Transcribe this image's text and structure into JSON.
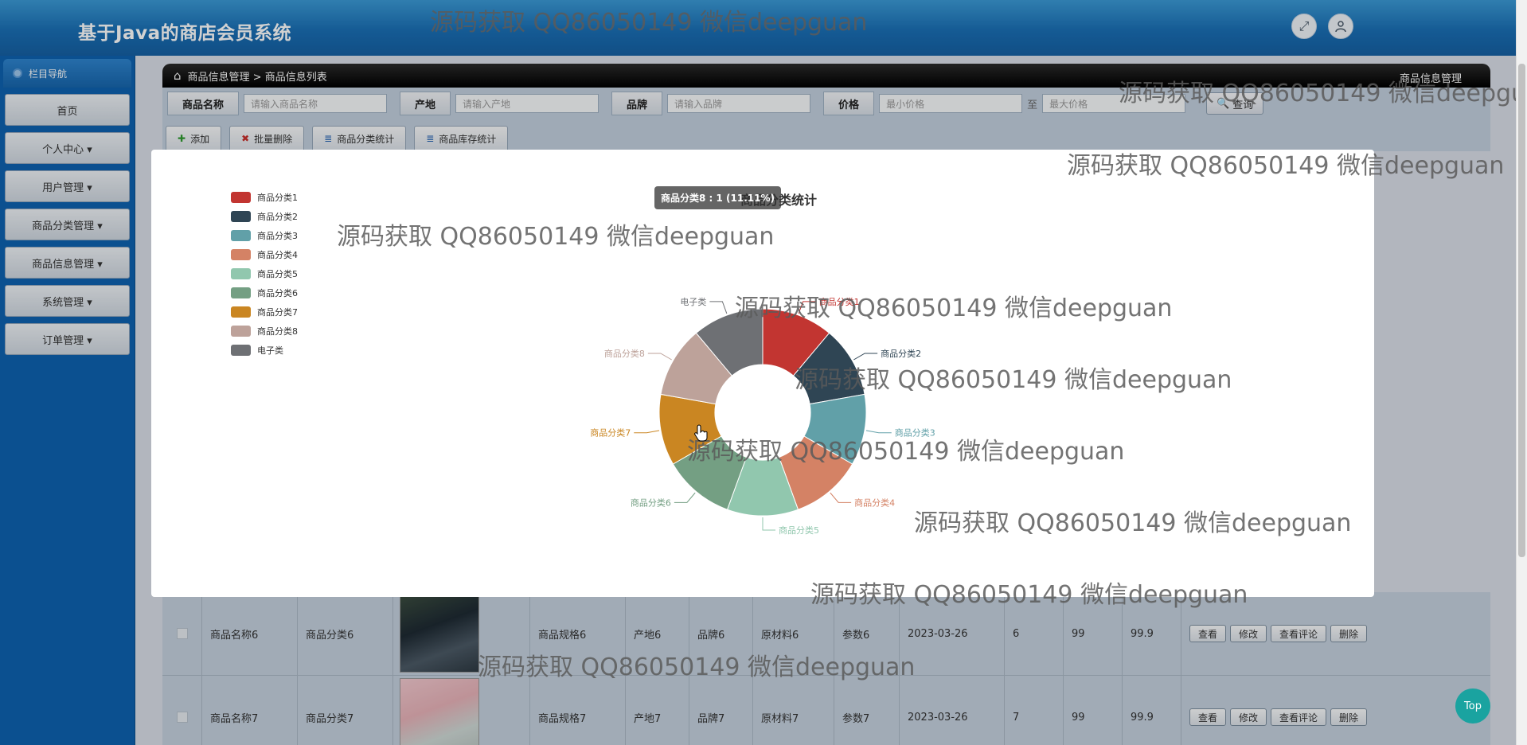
{
  "app": {
    "title": "基于Java的商店会员系统"
  },
  "header": {
    "fullscreen_icon": "expand-icon",
    "user_icon": "user-icon"
  },
  "sidebar": {
    "title": "栏目导航",
    "items": [
      {
        "label": "首页"
      },
      {
        "label": "个人中心 ▾"
      },
      {
        "label": "用户管理 ▾"
      },
      {
        "label": "商品分类管理 ▾"
      },
      {
        "label": "商品信息管理 ▾"
      },
      {
        "label": "系统管理 ▾"
      },
      {
        "label": "订单管理 ▾"
      }
    ]
  },
  "breadcrumb": {
    "home_icon": "home-icon",
    "path": "商品信息管理 > 商品信息列表",
    "right": "商品信息管理"
  },
  "search": {
    "name_label": "商品名称",
    "name_placeholder": "请输入商品名称",
    "origin_label": "产地",
    "origin_placeholder": "请输入产地",
    "brand_label": "品牌",
    "brand_placeholder": "请输入品牌",
    "price_label": "价格",
    "min_placeholder": "最小价格",
    "sep": "至",
    "max_placeholder": "最大价格",
    "query_label": "查询"
  },
  "toolbar": {
    "add_label": "添加",
    "batch_delete_label": "批量删除",
    "category_stats_label": "商品分类统计",
    "stock_stats_label": "商品库存统计"
  },
  "table": {
    "rows": [
      {
        "name": "商品名称6",
        "category": "商品分类6",
        "spec": "商品规格6",
        "origin": "产地6",
        "brand": "品牌6",
        "material": "原材料6",
        "param": "参数6",
        "date": "2023-03-26",
        "a": "6",
        "b": "99",
        "price": "99.9"
      },
      {
        "name": "商品名称7",
        "category": "商品分类7",
        "spec": "商品规格7",
        "origin": "产地7",
        "brand": "品牌7",
        "material": "原材料7",
        "param": "参数7",
        "date": "2023-03-26",
        "a": "7",
        "b": "99",
        "price": "99.9"
      }
    ],
    "actions": {
      "view": "查看",
      "edit": "修改",
      "comments": "查看评论",
      "delete": "删除"
    }
  },
  "chart_data": {
    "type": "pie",
    "donut": true,
    "title": "商品分类统计",
    "legend_position": "top-left",
    "categories": [
      "商品分类1",
      "商品分类2",
      "商品分类3",
      "商品分类4",
      "商品分类5",
      "商品分类6",
      "商品分类7",
      "商品分类8",
      "电子类"
    ],
    "values": [
      1,
      1,
      1,
      1,
      1,
      1,
      1,
      1,
      1
    ],
    "colors": [
      "#c23531",
      "#2f4554",
      "#61a0a8",
      "#d48265",
      "#91c7ae",
      "#749f83",
      "#ca8622",
      "#bda29a",
      "#6e7074"
    ],
    "tooltip": "商品分类8 : 1 (11.11%)"
  },
  "watermark": {
    "text": "源码获取 QQ86050149 微信deepguan"
  },
  "top_button": {
    "label": "Top"
  }
}
